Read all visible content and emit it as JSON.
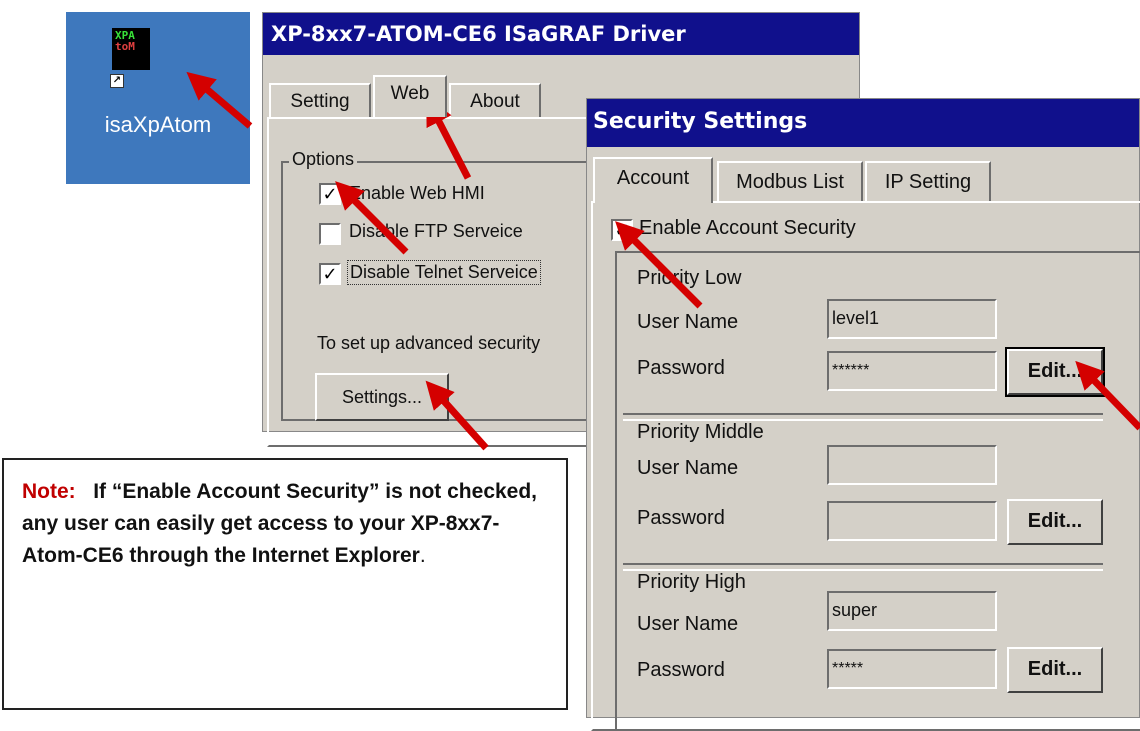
{
  "desktop": {
    "icon_lines": [
      "XPA",
      "toM"
    ],
    "shortcut_glyph": "↗",
    "app_label": "isaXpAtom"
  },
  "driver": {
    "title": "XP-8xx7-ATOM-CE6 ISaGRAF Driver",
    "tabs": [
      "Setting",
      "Web",
      "About"
    ],
    "group_label": "Options",
    "enable_web_hmi": "Enable Web HMI",
    "disable_ftp": "Disable FTP Serveice",
    "disable_telnet": "Disable Telnet Serveice",
    "advanced_text": "To set up advanced security",
    "settings_button": "Settings...",
    "check_mark": "✓"
  },
  "security": {
    "title": "Security Settings",
    "tabs": [
      "Account",
      "Modbus List",
      "IP Setting"
    ],
    "enable_account": "Enable Account Security",
    "low": {
      "header": "Priority Low",
      "user_label": "User Name",
      "user_value": "level1",
      "pass_label": "Password",
      "pass_value": "******",
      "edit": "Edit..."
    },
    "middle": {
      "header": "Priority Middle",
      "user_label": "User Name",
      "user_value": "",
      "pass_label": "Password",
      "pass_value": "",
      "edit": "Edit..."
    },
    "high": {
      "header": "Priority High",
      "user_label": "User Name",
      "user_value": "super",
      "pass_label": "Password",
      "pass_value": "*****",
      "edit": "Edit..."
    }
  },
  "note": {
    "prefix": "Note:",
    "body": "If “Enable Account Security” is not checked, any user can easily get access to your XP-8xx7-Atom-CE6 through the Internet Explorer",
    "suffix": "."
  },
  "colors": {
    "titlebar": "#10108c",
    "dialog_bg": "#d4d0c8",
    "desktop_bg": "#3e78bd",
    "arrow": "#d40000",
    "note_prefix": "#c00000"
  }
}
